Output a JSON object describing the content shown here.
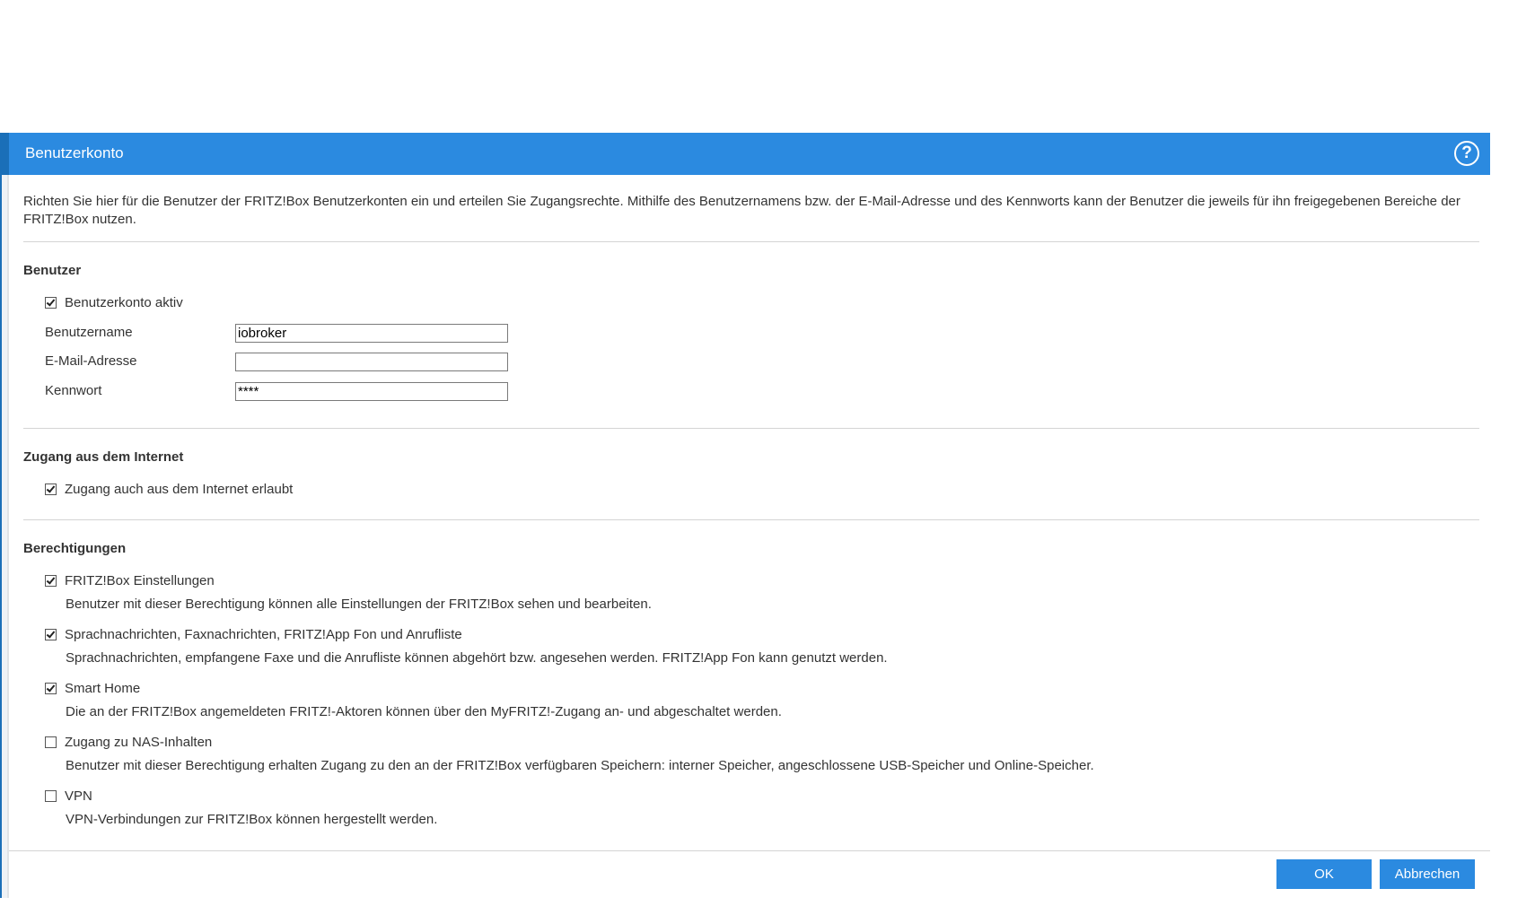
{
  "dialog": {
    "title": "Benutzerkonto",
    "intro": "Richten Sie hier für die Benutzer der FRITZ!Box Benutzerkonten ein und erteilen Sie Zugangsrechte. Mithilfe des Benutzernamens bzw. der E-Mail-Adresse und des Kennworts kann der Benutzer die jeweils für ihn freigegebenen Bereiche der FRITZ!Box nutzen."
  },
  "benutzer": {
    "heading": "Benutzer",
    "active_label": "Benutzerkonto aktiv",
    "active_checked": true,
    "username_label": "Benutzername",
    "username_value": "iobroker",
    "email_label": "E-Mail-Adresse",
    "email_value": "",
    "password_label": "Kennwort",
    "password_value": "****"
  },
  "internet": {
    "heading": "Zugang aus dem Internet",
    "allow_label": "Zugang auch aus dem Internet erlaubt",
    "allow_checked": true
  },
  "permissions": {
    "heading": "Berechtigungen",
    "items": [
      {
        "label": "FRITZ!Box Einstellungen",
        "checked": true,
        "description": "Benutzer mit dieser Berechtigung können alle Einstellungen der FRITZ!Box sehen und bearbeiten."
      },
      {
        "label": "Sprachnachrichten, Faxnachrichten, FRITZ!App Fon und Anrufliste",
        "checked": true,
        "description": "Sprachnachrichten, empfangene Faxe und die Anrufliste können abgehört bzw. angesehen werden. FRITZ!App Fon kann genutzt werden."
      },
      {
        "label": "Smart Home",
        "checked": true,
        "description": "Die an der FRITZ!Box angemeldeten FRITZ!-Aktoren können über den MyFRITZ!-Zugang an- und abgeschaltet werden."
      },
      {
        "label": "Zugang zu NAS-Inhalten",
        "checked": false,
        "description": "Benutzer mit dieser Berechtigung erhalten Zugang zu den an der FRITZ!Box verfügbaren Speichern: interner Speicher, angeschlossene USB-Speicher und Online-Speicher."
      },
      {
        "label": "VPN",
        "checked": false,
        "description": "VPN-Verbindungen zur FRITZ!Box können hergestellt werden."
      }
    ]
  },
  "buttons": {
    "ok": "OK",
    "cancel": "Abbrechen"
  },
  "colors": {
    "titlebar": "#2b8ae0",
    "button": "#2b8ae0"
  },
  "icons": {
    "help": "question-circle-icon"
  }
}
